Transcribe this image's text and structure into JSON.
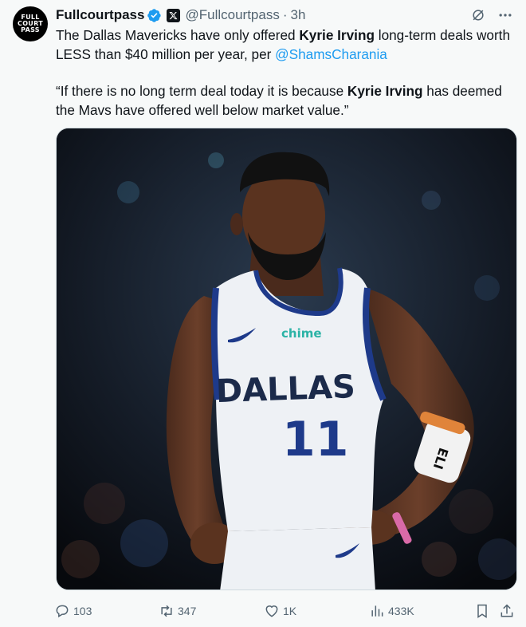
{
  "author": {
    "avatar_lines": [
      "FULL",
      "COURT",
      "PASS"
    ],
    "name": "Fullcourtpass",
    "handle": "@Fullcourtpass",
    "separator": "·",
    "time": "3h"
  },
  "tweet": {
    "p1_a": "The Dallas Mavericks have only offered ",
    "p1_bold": "Kyrie Irving",
    "p1_b": " long-term deals worth LESS than $40 million per year, per ",
    "p1_mention": "@ShamsCharania",
    "p2_a": "“If there is no long term deal today it is because ",
    "p2_bold": "Kyrie Irving",
    "p2_b": " has deemed the Mavs have offered well below market value.”"
  },
  "image": {
    "jersey_sponsor": "chime",
    "jersey_team": "DALLAS",
    "jersey_number": "11",
    "wristband_text": "ELI"
  },
  "actions": {
    "replies": "103",
    "reposts": "347",
    "likes": "1K",
    "views": "433K"
  },
  "colors": {
    "accent": "#1d9bf0",
    "text": "#0f1419",
    "muted": "#536471",
    "background": "#f7f9f9"
  },
  "icons": [
    "verified-badge-icon",
    "x-premium-icon",
    "grok-icon",
    "more-icon",
    "reply-icon",
    "repost-icon",
    "like-icon",
    "views-icon",
    "bookmark-icon",
    "share-icon"
  ]
}
